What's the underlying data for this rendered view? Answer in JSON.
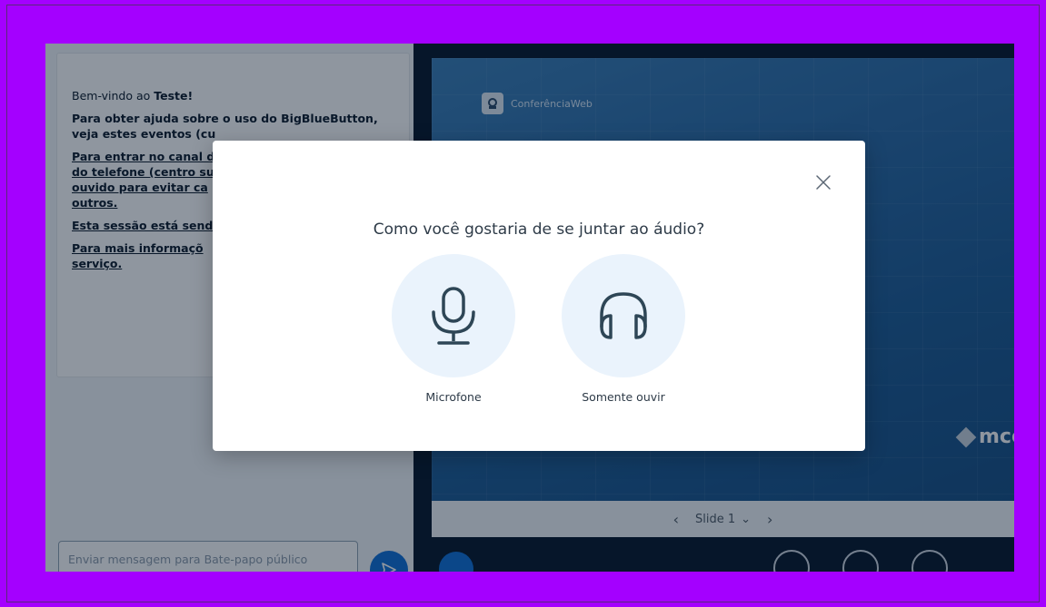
{
  "chat": {
    "welcome_prefix": "Bem-vindo ao ",
    "welcome_room": "Teste!",
    "help_text_line1": "Para obter ajuda sobre o uso do BigBlueButton,",
    "help_text_line2": "veja estes eventos (cu",
    "link_phone_1": "Para entrar no canal d",
    "link_phone_2": "do telefone (centro su",
    "link_phone_3": "ouvido para evitar ca",
    "link_phone_4": "outros.",
    "link_recording": "Esta sessão está send",
    "link_info_1": "Para mais informaçõ",
    "link_info_2": "serviço.",
    "input_placeholder": "Enviar mensagem para Bate-papo público"
  },
  "presentation": {
    "slide_logo_text": "ConferênciaWeb",
    "slide_brand_text": "mco",
    "slide_label": "Slide 1",
    "prev_arrow": "‹",
    "next_arrow": "›",
    "dropdown_arrow": "⌄"
  },
  "modal": {
    "title": "Como você gostaria de se juntar ao áudio?",
    "close_glyph": "✕",
    "options": [
      {
        "label": "Microfone",
        "icon": "microphone-icon"
      },
      {
        "label": "Somente ouvir",
        "icon": "headphones-icon"
      }
    ]
  },
  "colors": {
    "frame": "#a400ff",
    "accent": "#0f70d7",
    "option_bg": "#eaf3fc",
    "icon_stroke": "#2e4656"
  }
}
